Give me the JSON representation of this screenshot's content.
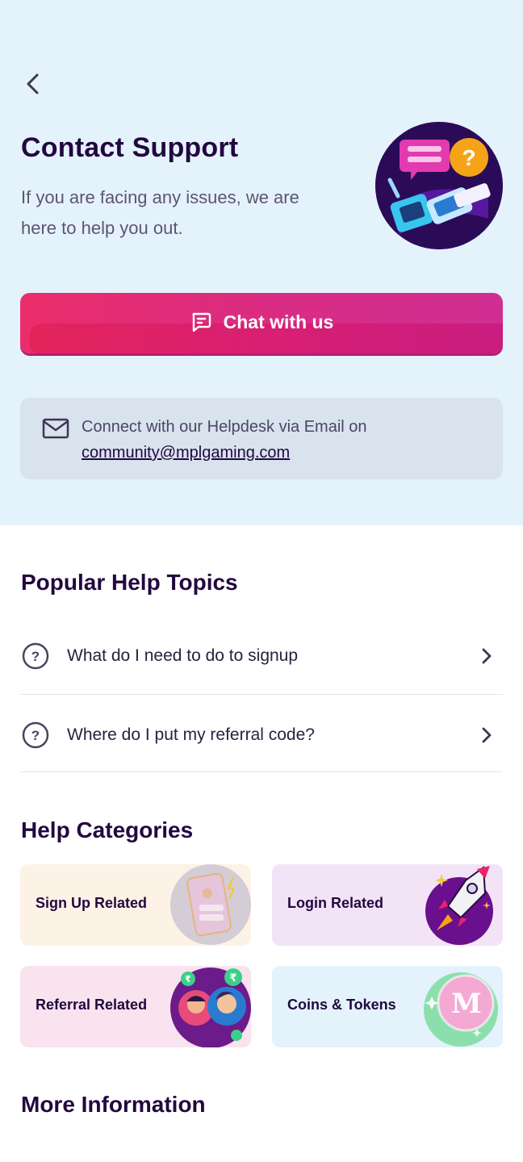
{
  "header": {
    "title": "Contact Support",
    "subtitle_line1": "If you are facing any issues, we are",
    "subtitle_line2": "here to help you out."
  },
  "chat_button": {
    "label": "Chat with us"
  },
  "email_card": {
    "text": "Connect with our Helpdesk via Email on",
    "email": "community@mplgaming.com"
  },
  "popular": {
    "title": "Popular Help Topics",
    "topics": [
      {
        "label": "What do I need to do to signup"
      },
      {
        "label": "Where do I put my referral code?"
      }
    ]
  },
  "categories": {
    "title": "Help Categories",
    "items": [
      {
        "label": "Sign Up Related",
        "bg": "#fdf2e6"
      },
      {
        "label": "Login Related",
        "bg": "#f2e4f6"
      },
      {
        "label": "Referral Related",
        "bg": "#f8e3ee"
      },
      {
        "label": "Coins & Tokens",
        "bg": "#e3f2fb"
      }
    ]
  },
  "more": {
    "title": "More Information"
  },
  "colors": {
    "accent_pink": "#e02d72",
    "dark_purple": "#22083f",
    "header_bg": "#e4f2fc"
  },
  "icons": [
    "back-arrow-icon",
    "chat-icon",
    "mail-icon",
    "question-circle-icon",
    "chevron-right-icon"
  ]
}
